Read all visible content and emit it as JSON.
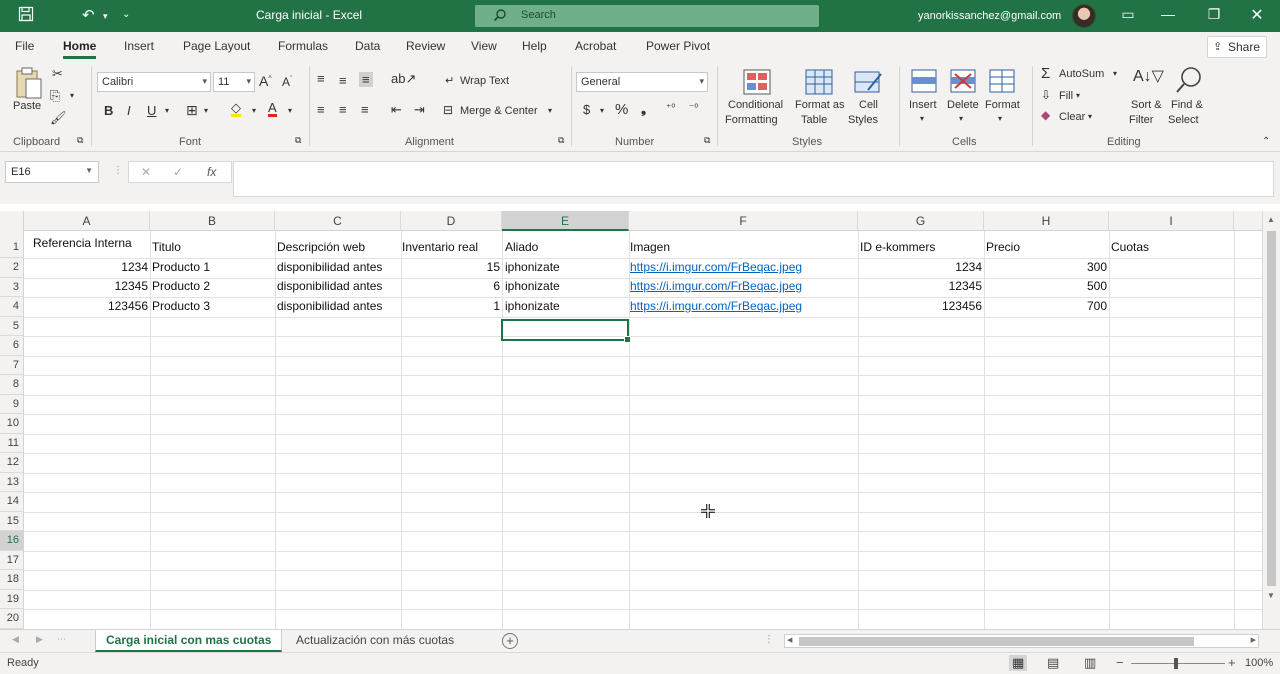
{
  "titlebar": {
    "title": "Carga inicial  -  Excel",
    "search_placeholder": "Search",
    "account": "yanorkissanchez@gmail.com"
  },
  "tabs": [
    "File",
    "Home",
    "Insert",
    "Page Layout",
    "Formulas",
    "Data",
    "Review",
    "View",
    "Help",
    "Acrobat",
    "Power Pivot"
  ],
  "active_tab": "Home",
  "share_label": "Share",
  "ribbon": {
    "clipboard": {
      "paste": "Paste",
      "label": "Clipboard"
    },
    "font": {
      "name": "Calibri",
      "size": "11",
      "label": "Font"
    },
    "alignment": {
      "wrap": "Wrap Text",
      "merge": "Merge & Center",
      "label": "Alignment"
    },
    "number": {
      "format": "General",
      "label": "Number"
    },
    "styles": {
      "cond_1": "Conditional",
      "cond_2": "Formatting",
      "table_1": "Format as",
      "table_2": "Table",
      "cell_1": "Cell",
      "cell_2": "Styles",
      "label": "Styles"
    },
    "cells": {
      "insert": "Insert",
      "delete": "Delete",
      "format": "Format",
      "label": "Cells"
    },
    "editing": {
      "autosum": "AutoSum",
      "fill": "Fill",
      "clear": "Clear",
      "sort_1": "Sort &",
      "sort_2": "Filter",
      "find_1": "Find &",
      "find_2": "Select",
      "label": "Editing"
    }
  },
  "formula_bar": {
    "name_box": "E16",
    "formula": ""
  },
  "columns": [
    "A",
    "B",
    "C",
    "D",
    "E",
    "F",
    "G",
    "H",
    "I"
  ],
  "selected_column": "E",
  "rows": [
    "1",
    "2",
    "3",
    "4",
    "5",
    "6",
    "7",
    "8",
    "9",
    "10",
    "11",
    "12",
    "13",
    "14",
    "15",
    "16",
    "17",
    "18",
    "19",
    "20"
  ],
  "selected_row": "16",
  "sheet": {
    "header": {
      "a": "Referencia Interna",
      "b": "Titulo",
      "c": "Descripción web",
      "d": "Inventario real",
      "e": "Aliado",
      "f": "Imagen",
      "g": "ID e-kommers",
      "h": "Precio",
      "i": "Cuotas"
    },
    "data": [
      {
        "a": "1234",
        "b": "Producto 1",
        "c": "disponibilidad antes",
        "d": "15",
        "e": "iphonizate",
        "f": "https://i.imgur.com/FrBeqac.jpeg",
        "g": "1234",
        "h": "300"
      },
      {
        "a": "12345",
        "b": "Producto 2",
        "c": "disponibilidad antes",
        "d": "6",
        "e": "iphonizate",
        "f": "https://i.imgur.com/FrBeqac.jpeg",
        "g": "12345",
        "h": "500"
      },
      {
        "a": "123456",
        "b": "Producto 3",
        "c": "disponibilidad antes",
        "d": "1",
        "e": "iphonizate",
        "f": "https://i.imgur.com/FrBeqac.jpeg",
        "g": "123456",
        "h": "700"
      }
    ]
  },
  "sheet_tabs": [
    "Carga inicial con mas cuotas",
    "Actualización con más cuotas"
  ],
  "status": {
    "ready": "Ready",
    "zoom": "100%"
  },
  "colors": {
    "accent": "#217346",
    "link": "#0563c1"
  }
}
